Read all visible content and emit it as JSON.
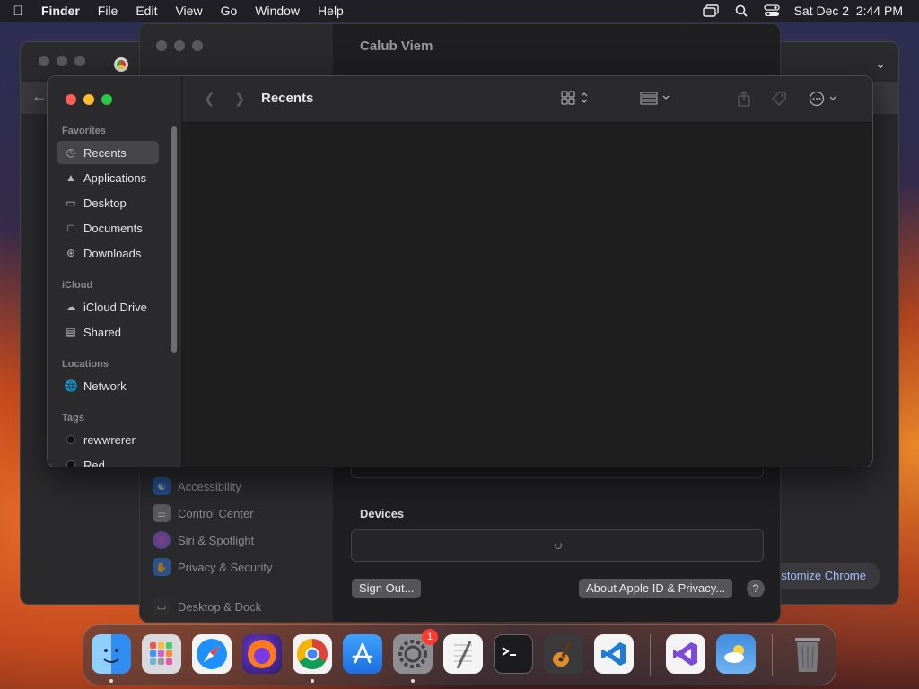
{
  "menubar": {
    "app_name": "Finder",
    "items": [
      "File",
      "Edit",
      "View",
      "Go",
      "Window",
      "Help"
    ],
    "datetime": "Sat Dec 2  2:44 PM"
  },
  "chrome": {
    "customize_label": "ustomize Chrome"
  },
  "settings": {
    "title": "Calub Viem",
    "sidebar_items": [
      {
        "label": "Accessibility",
        "color": "#1f6fe0"
      },
      {
        "label": "Control Center",
        "color": "#8a8a8e"
      },
      {
        "label": "Siri & Spotlight",
        "color": "#c24bd8"
      },
      {
        "label": "Privacy & Security",
        "color": "#2f7ae0"
      },
      {
        "label": "Desktop & Dock",
        "color": "#333336"
      }
    ],
    "devices_label": "Devices",
    "sign_out_label": "Sign Out...",
    "about_label": "About Apple ID & Privacy...",
    "help_label": "?"
  },
  "finder": {
    "title": "Recents",
    "sections": {
      "favorites": "Favorites",
      "icloud": "iCloud",
      "locations": "Locations",
      "tags": "Tags"
    },
    "favorites": [
      "Recents",
      "Applications",
      "Desktop",
      "Documents",
      "Downloads"
    ],
    "icloud": [
      "iCloud Drive",
      "Shared"
    ],
    "locations": [
      "Network"
    ],
    "tags": [
      "rewwrerer",
      "Red"
    ]
  },
  "dock": {
    "apps": [
      {
        "name": "Finder",
        "icon": "finder-icon",
        "color": "#2f8cf0"
      },
      {
        "name": "Launchpad",
        "icon": "launchpad-icon",
        "color": "#d9d9de"
      },
      {
        "name": "Safari",
        "icon": "safari-icon",
        "color": "#1e90ff"
      },
      {
        "name": "Firefox",
        "icon": "firefox-icon",
        "color": "#ff7a1a"
      },
      {
        "name": "Chrome",
        "icon": "chrome-icon",
        "color": "#f2f2f2"
      },
      {
        "name": "App Store",
        "icon": "app-store-icon",
        "color": "#1c7ef0"
      },
      {
        "name": "System Settings",
        "icon": "system-settings-icon",
        "color": "#8e8e93",
        "badge": "1"
      },
      {
        "name": "TextEdit",
        "icon": "textedit-icon",
        "color": "#f4f4f4"
      },
      {
        "name": "Terminal",
        "icon": "terminal-icon",
        "color": "#1c1c1e"
      },
      {
        "name": "GarageBand",
        "icon": "garageband-icon",
        "color": "#3a3a3c"
      },
      {
        "name": "VS Code",
        "icon": "vscode-icon",
        "color": "#f4f4f4"
      },
      {
        "name": "Visual Studio",
        "icon": "visual-studio-icon",
        "color": "#f4f4f4"
      },
      {
        "name": "Weather",
        "icon": "weather-icon",
        "color": "#3d8de0"
      },
      {
        "name": "Trash",
        "icon": "trash-icon",
        "color": "#7a7a7e"
      }
    ]
  }
}
